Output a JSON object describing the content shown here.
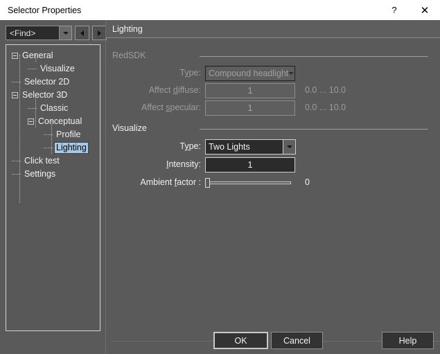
{
  "window": {
    "title": "Selector Properties",
    "help_icon": "?",
    "close_icon": "✕"
  },
  "toolbar": {
    "find_value": "<Find>",
    "dropdown_icon": "chevron-down",
    "back_icon": "◀",
    "forward_icon": "▶"
  },
  "tree": {
    "items": [
      {
        "label": "General",
        "level": 0,
        "expander": "minus",
        "selected": false
      },
      {
        "label": "Visualize",
        "level": 1,
        "expander": "none",
        "selected": false
      },
      {
        "label": "Selector 2D",
        "level": 0,
        "expander": "none",
        "selected": false
      },
      {
        "label": "Selector 3D",
        "level": 0,
        "expander": "minus",
        "selected": false
      },
      {
        "label": "Classic",
        "level": 1,
        "expander": "none",
        "selected": false
      },
      {
        "label": "Conceptual",
        "level": 1,
        "expander": "minus",
        "selected": false
      },
      {
        "label": "Profile",
        "level": 2,
        "expander": "none",
        "selected": false
      },
      {
        "label": "Lighting",
        "level": 2,
        "expander": "none",
        "selected": true
      },
      {
        "label": "Click test",
        "level": 0,
        "expander": "none",
        "selected": false
      },
      {
        "label": "Settings",
        "level": 0,
        "expander": "none",
        "selected": false
      }
    ]
  },
  "panel": {
    "header_title": "Lighting",
    "redsdk": {
      "group_title": "RedSDK",
      "enabled": false,
      "type_label_pre": "T",
      "type_label_mnemonic": "y",
      "type_label_post": "pe:",
      "type_value": "Compound headlight",
      "affect_diffuse_label_pre": "Affect ",
      "affect_diffuse_mnemonic": "d",
      "affect_diffuse_label_post": "iffuse:",
      "affect_diffuse_value": "1",
      "affect_diffuse_range": "0.0 ... 10.0",
      "affect_specular_label_pre": "Affect ",
      "affect_specular_mnemonic": "s",
      "affect_specular_label_post": "pecular:",
      "affect_specular_value": "1",
      "affect_specular_range": "0.0 ... 10.0"
    },
    "visualize": {
      "group_title": "Visualize",
      "enabled": true,
      "type_label_pre": "T",
      "type_label_mnemonic": "y",
      "type_label_post": "pe:",
      "type_value": "Two Lights",
      "intensity_label_pre": "",
      "intensity_mnemonic": "I",
      "intensity_label_post": "ntensity:",
      "intensity_value": "1",
      "ambient_label_pre": "Ambient ",
      "ambient_mnemonic": "f",
      "ambient_label_post": "actor :",
      "ambient_value": "0",
      "ambient_slider_percent": 0
    }
  },
  "footer": {
    "ok_label": "OK",
    "cancel_label": "Cancel",
    "help_label": "Help"
  },
  "colors": {
    "dialog_bg": "#5a5a5a",
    "titlebar_bg": "#ffffff",
    "field_bg": "#2b2b2b",
    "selection_bg": "#a8c8e8",
    "disabled_text": "#9c9c9c",
    "enabled_text": "#f0f0f0"
  }
}
